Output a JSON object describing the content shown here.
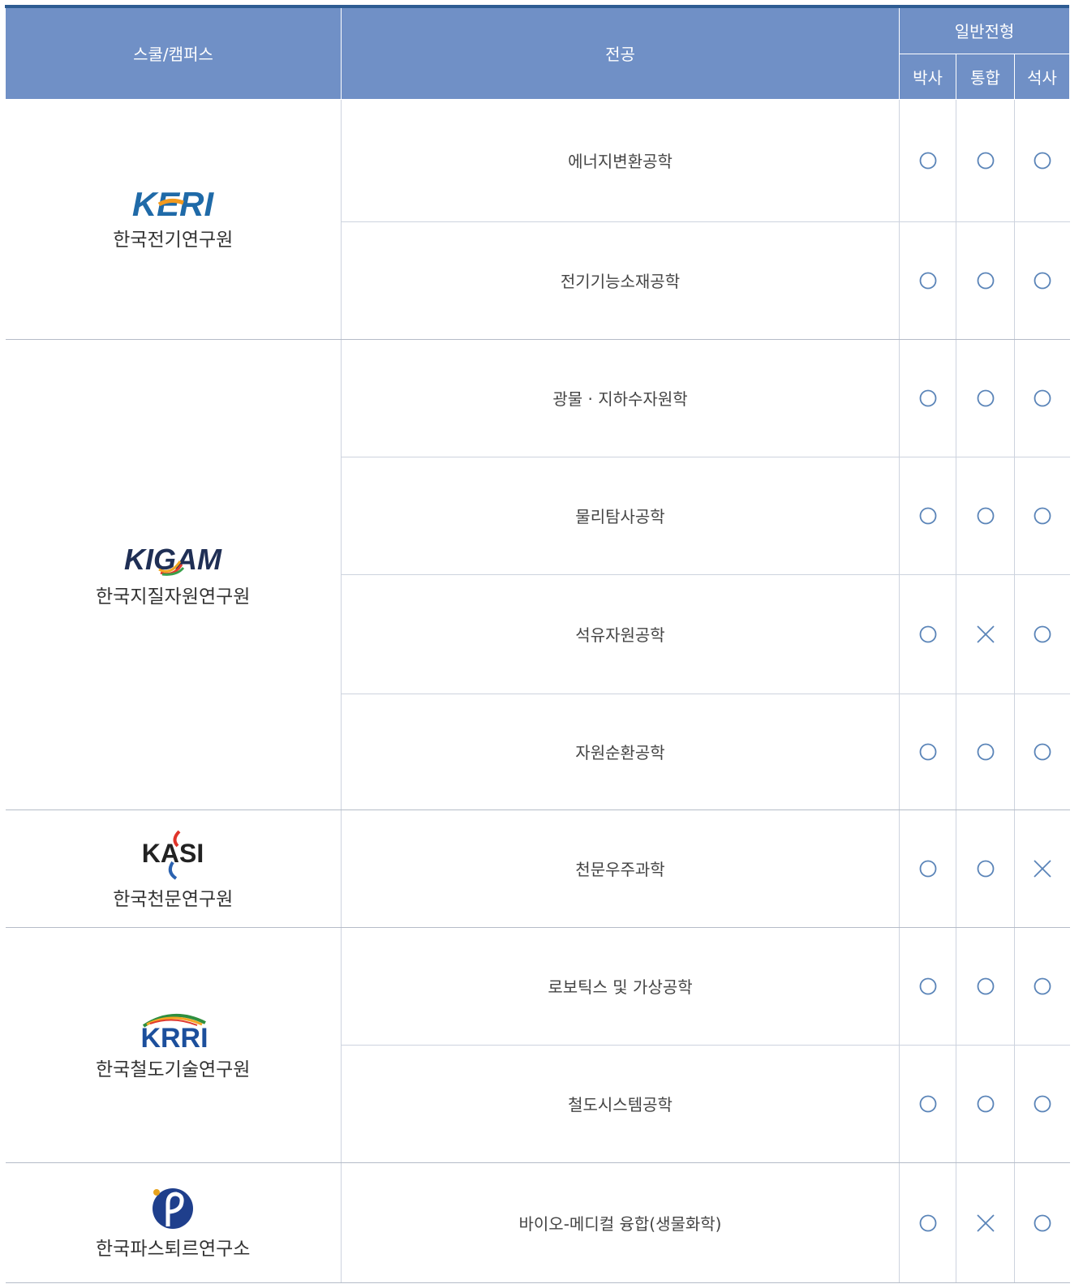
{
  "header": {
    "school_col": "스쿨/캠퍼스",
    "major_col": "전공",
    "group_col": "일반전형",
    "sub_cols": [
      "박사",
      "통합",
      "석사"
    ]
  },
  "schools": [
    {
      "logo_text": "KERI",
      "name": "한국전기연구원",
      "majors": [
        {
          "name": "에너지변환공학",
          "marks": [
            "circle",
            "circle",
            "circle"
          ]
        },
        {
          "name": "전기기능소재공학",
          "marks": [
            "circle",
            "circle",
            "circle"
          ]
        }
      ]
    },
    {
      "logo_text": "KIGAM",
      "name": "한국지질자원연구원",
      "majors": [
        {
          "name": "광물 · 지하수자원학",
          "marks": [
            "circle",
            "circle",
            "circle"
          ]
        },
        {
          "name": "물리탐사공학",
          "marks": [
            "circle",
            "circle",
            "circle"
          ]
        },
        {
          "name": "석유자원공학",
          "marks": [
            "circle",
            "cross",
            "circle"
          ]
        },
        {
          "name": "자원순환공학",
          "marks": [
            "circle",
            "circle",
            "circle"
          ]
        }
      ]
    },
    {
      "logo_text": "KASI",
      "name": "한국천문연구원",
      "majors": [
        {
          "name": "천문우주과학",
          "marks": [
            "circle",
            "circle",
            "cross"
          ]
        }
      ]
    },
    {
      "logo_text": "KRRI",
      "name": "한국철도기술연구원",
      "majors": [
        {
          "name": "로보틱스 및 가상공학",
          "marks": [
            "circle",
            "circle",
            "circle"
          ]
        },
        {
          "name": "철도시스템공학",
          "marks": [
            "circle",
            "circle",
            "circle"
          ]
        }
      ]
    },
    {
      "logo_text": "",
      "name": "한국파스퇴르연구소",
      "majors": [
        {
          "name": "바이오-메디컬 융합(생물화학)",
          "marks": [
            "circle",
            "cross",
            "circle"
          ]
        }
      ]
    }
  ],
  "colors": {
    "header_bg": "#7090c6",
    "top_bar": "#2e5c92",
    "mark": "#5a84b8"
  }
}
